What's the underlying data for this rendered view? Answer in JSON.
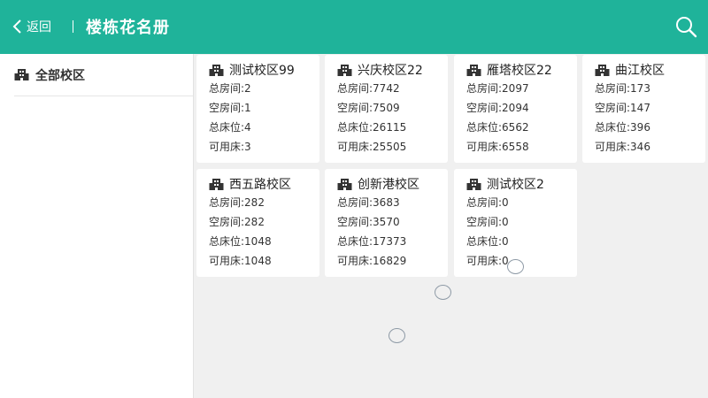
{
  "header": {
    "back_label": "返回",
    "title": "楼栋花名册",
    "background": "#1fb39a"
  },
  "sidebar": {
    "items": [
      {
        "label": "全部校区",
        "icon": "building-icon"
      }
    ]
  },
  "labels": {
    "rooms_total": "总房间:",
    "rooms_empty": "空房间:",
    "beds_total": "总床位:",
    "beds_available": "可用床:"
  },
  "campuses": [
    {
      "name": "测试校区99",
      "rooms_total": "2",
      "rooms_empty": "1",
      "beds_total": "4",
      "beds_available": "3"
    },
    {
      "name": "兴庆校区22",
      "rooms_total": "7742",
      "rooms_empty": "7509",
      "beds_total": "26115",
      "beds_available": "25505"
    },
    {
      "name": "雁塔校区22",
      "rooms_total": "2097",
      "rooms_empty": "2094",
      "beds_total": "6562",
      "beds_available": "6558"
    },
    {
      "name": "曲江校区",
      "rooms_total": "173",
      "rooms_empty": "147",
      "beds_total": "396",
      "beds_available": "346"
    },
    {
      "name": "西五路校区",
      "rooms_total": "282",
      "rooms_empty": "282",
      "beds_total": "1048",
      "beds_available": "1048"
    },
    {
      "name": "创新港校区",
      "rooms_total": "3683",
      "rooms_empty": "3570",
      "beds_total": "17373",
      "beds_available": "16829"
    },
    {
      "name": "测试校区2",
      "rooms_total": "0",
      "rooms_empty": "0",
      "beds_total": "0",
      "beds_available": "0"
    }
  ]
}
